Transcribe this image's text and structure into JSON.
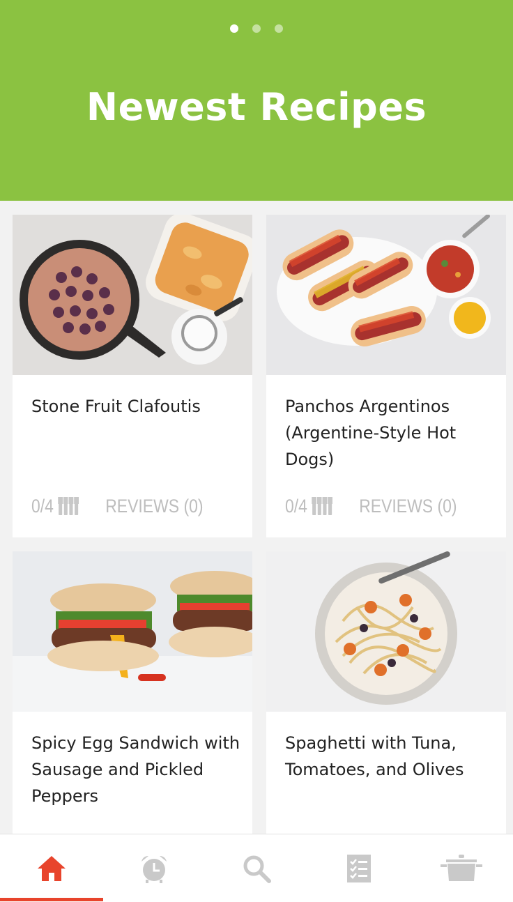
{
  "header": {
    "title": "Newest Recipes",
    "pager": {
      "count": 3,
      "active_index": 0
    }
  },
  "colors": {
    "header_bg": "#8bc241",
    "accent": "#e8442c",
    "muted_text": "#bdbdbd"
  },
  "recipes": [
    {
      "title": "Stone Fruit Clafoutis",
      "rating": "0/4",
      "reviews": "REVIEWS (0)",
      "image": "clafoutis-skillet-photo"
    },
    {
      "title": "Panchos Argentinos (Argentine-Style Hot Dogs)",
      "rating": "0/4",
      "reviews": "REVIEWS (0)",
      "image": "hot-dogs-platter-photo"
    },
    {
      "title": "Spicy Egg Sandwich with Sausage and Pickled Peppers",
      "rating": "",
      "reviews": "",
      "image": "egg-sandwich-photo"
    },
    {
      "title": "Spaghetti with Tuna, Tomatoes, and Olives",
      "rating": "",
      "reviews": "",
      "image": "spaghetti-bowl-photo"
    }
  ],
  "tabbar": {
    "items": [
      {
        "name": "home",
        "icon": "home-icon",
        "active": true
      },
      {
        "name": "timer",
        "icon": "alarm-clock-icon",
        "active": false
      },
      {
        "name": "search",
        "icon": "search-icon",
        "active": false
      },
      {
        "name": "shopping-list",
        "icon": "checklist-icon",
        "active": false
      },
      {
        "name": "recipe-box",
        "icon": "pot-icon",
        "active": false
      }
    ]
  }
}
